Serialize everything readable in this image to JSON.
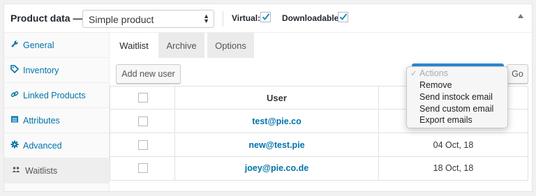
{
  "header": {
    "title": "Product data —",
    "product_type": "Simple product",
    "virtual_label": "Virtual:",
    "downloadable_label": "Downloadable:",
    "virtual_checked": true,
    "downloadable_checked": true
  },
  "sidebar": {
    "items": [
      {
        "label": "General",
        "icon": "wrench-icon"
      },
      {
        "label": "Inventory",
        "icon": "tag-icon"
      },
      {
        "label": "Linked Products",
        "icon": "link-icon"
      },
      {
        "label": "Attributes",
        "icon": "list-icon"
      },
      {
        "label": "Advanced",
        "icon": "gear-icon"
      },
      {
        "label": "Waitlists",
        "icon": "users-icon",
        "active": true
      }
    ]
  },
  "tabs": [
    "Waitlist",
    "Archive",
    "Options"
  ],
  "toolbar": {
    "add_user": "Add new user",
    "go": "Go"
  },
  "actions_menu": {
    "selected": "Actions",
    "options": [
      "Remove",
      "Send instock email",
      "Send custom email",
      "Export emails"
    ]
  },
  "table": {
    "header_user": "User",
    "rows": [
      {
        "user": "test@pie.co",
        "date": ""
      },
      {
        "user": "new@test.pie",
        "date": "04 Oct, 18"
      },
      {
        "user": "joey@pie.co.de",
        "date": "18 Oct, 18"
      }
    ]
  },
  "colors": {
    "link": "#0073aa",
    "accent": "#2c8bd6"
  }
}
